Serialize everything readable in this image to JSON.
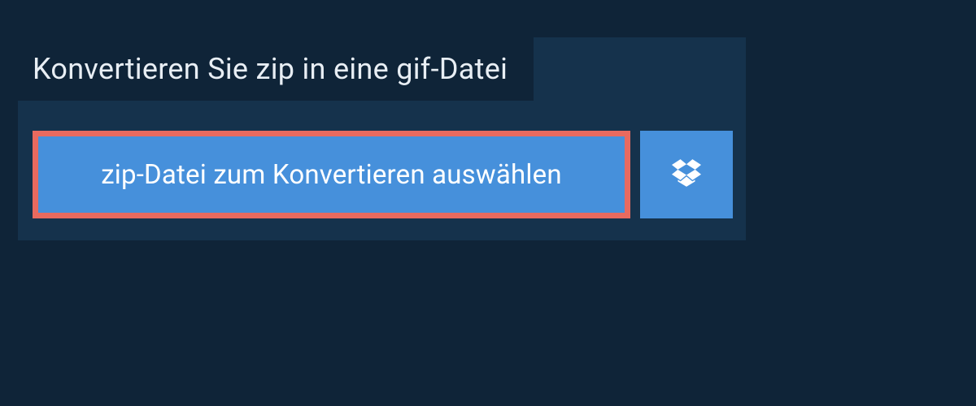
{
  "header": {
    "title": "Konvertieren Sie zip in eine gif-Datei"
  },
  "actions": {
    "select_file_label": "zip-Datei zum Konvertieren auswählen",
    "dropbox_icon_name": "dropbox-icon"
  },
  "colors": {
    "page_bg": "#0f2438",
    "panel_bg": "#15324c",
    "button_bg": "#4690db",
    "highlight_border": "#e86a5f",
    "text_light": "#e8eef4",
    "text_white": "#ffffff"
  }
}
